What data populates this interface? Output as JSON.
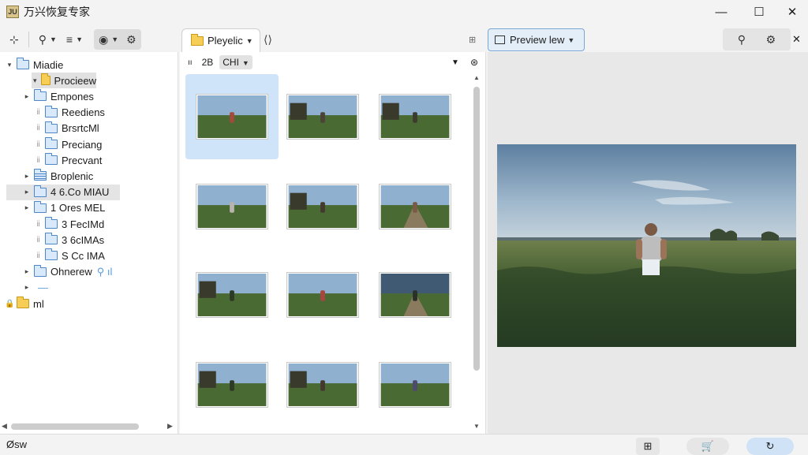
{
  "app": {
    "logo_text": "JU",
    "title": "万兴恢复专家"
  },
  "window_controls": {
    "minimize": "—",
    "maximize": "☐",
    "close": "✕"
  },
  "toolbar_left": {
    "group1": "⊹",
    "group2": "⚲",
    "group3": "≡",
    "group4": "◉",
    "group5": "⚙"
  },
  "tab_mid": {
    "label": "Pleyelic",
    "back": "⟨⟩"
  },
  "tab_mid_extra": "⊞",
  "mid_header": {
    "label1": "ıı",
    "label2": "2B",
    "label3": "CHI"
  },
  "mid_header_right": "⊛",
  "preview_tab": {
    "label": "Preview lew"
  },
  "right_toolbar": {
    "search": "⚲",
    "settings": "⚙",
    "close": "✕"
  },
  "tree": [
    {
      "label": "Miadie",
      "indent": "root",
      "expander": "▾",
      "folder": "blue"
    },
    {
      "label": "Procieew",
      "indent": "l1",
      "expander": "▾",
      "folder": "yellow",
      "state": "selected"
    },
    {
      "label": "Empones",
      "indent": "l1",
      "expander": "▸",
      "folder": "blue"
    },
    {
      "label": "Reediens",
      "indent": "l2",
      "expander": "dots",
      "folder": "blue"
    },
    {
      "label": "BrsrtcMl",
      "indent": "l2",
      "expander": "dots",
      "folder": "blue"
    },
    {
      "label": "Preciang",
      "indent": "l2",
      "expander": "dots",
      "folder": "blue"
    },
    {
      "label": "Precvant",
      "indent": "l2",
      "expander": "dots",
      "folder": "blue"
    },
    {
      "label": "Broplenic",
      "indent": "l1",
      "expander": "▸",
      "folder": "lined"
    },
    {
      "label": "4 6.Co MIAU",
      "indent": "l1",
      "expander": "▸",
      "folder": "blue",
      "state": "highlight"
    },
    {
      "label": "1 Ores MEL",
      "indent": "l1",
      "expander": "▸",
      "folder": "blue"
    },
    {
      "label": "3 FecIMd",
      "indent": "l2",
      "expander": "dots",
      "folder": "blue"
    },
    {
      "label": "3 6cIMAs",
      "indent": "l2",
      "expander": "dots",
      "folder": "blue"
    },
    {
      "label": "S Cc IMA",
      "indent": "l2",
      "expander": "dots",
      "folder": "blue"
    },
    {
      "label": "Ohnerew",
      "indent": "l1",
      "expander": "▸",
      "folder": "blue",
      "suffix": "⚲ ıl"
    },
    {
      "label": "—",
      "indent": "l1",
      "expander": "▸",
      "folder": "none"
    },
    {
      "label": "ml",
      "indent": "root",
      "expander": "lock",
      "folder": "yellow"
    }
  ],
  "thumbnails": [
    {
      "name": "thumb-1",
      "selected": true,
      "scene": "person-sitting"
    },
    {
      "name": "thumb-2",
      "scene": "ruins-path"
    },
    {
      "name": "thumb-3",
      "scene": "ruins-field"
    },
    {
      "name": "thumb-4",
      "scene": "person-standing"
    },
    {
      "name": "thumb-5",
      "scene": "ruins-person"
    },
    {
      "name": "thumb-6",
      "scene": "road-person"
    },
    {
      "name": "thumb-7",
      "scene": "trees-ruins"
    },
    {
      "name": "thumb-8",
      "scene": "person-red"
    },
    {
      "name": "thumb-9",
      "scene": "dark-road"
    },
    {
      "name": "thumb-10",
      "scene": "trees-ruins"
    },
    {
      "name": "thumb-11",
      "scene": "ruins-person"
    },
    {
      "name": "thumb-12",
      "scene": "person-field"
    }
  ],
  "status": {
    "left_label": "Øsw",
    "grid": "⊞",
    "cart": "🛒",
    "refresh": "↻"
  },
  "colors": {
    "accent": "#5a9be0",
    "selection": "#cfe4f8",
    "sky": "#6b93b8",
    "grass": "#3c5a2c"
  }
}
